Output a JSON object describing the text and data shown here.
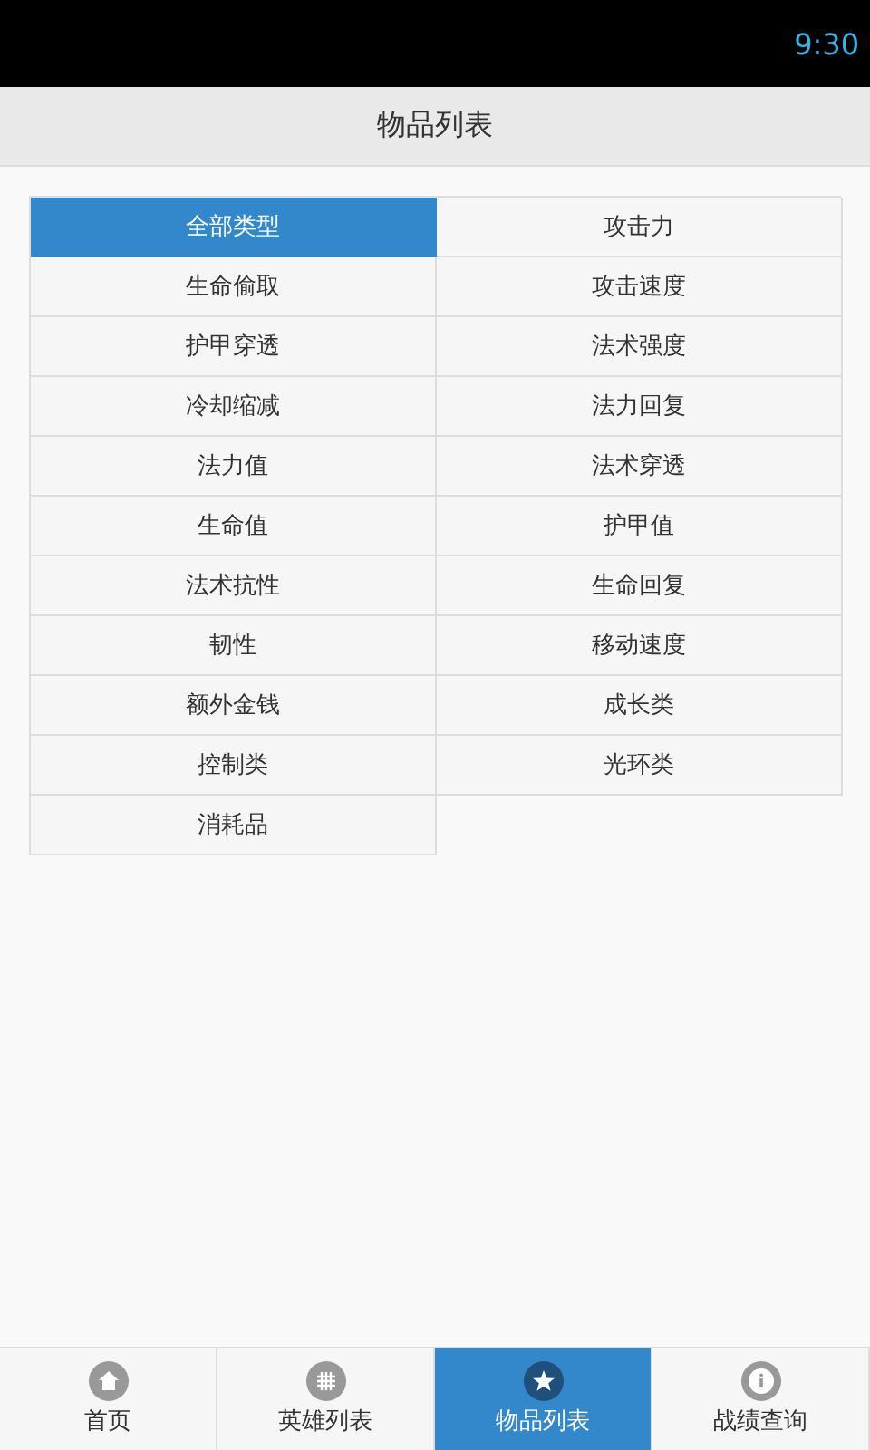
{
  "status_bar": {
    "time": "9:30"
  },
  "header": {
    "title": "物品列表"
  },
  "categories": [
    {
      "label": "全部类型",
      "selected": true
    },
    {
      "label": "攻击力",
      "selected": false
    },
    {
      "label": "生命偷取",
      "selected": false
    },
    {
      "label": "攻击速度",
      "selected": false
    },
    {
      "label": "护甲穿透",
      "selected": false
    },
    {
      "label": "法术强度",
      "selected": false
    },
    {
      "label": "冷却缩减",
      "selected": false
    },
    {
      "label": "法力回复",
      "selected": false
    },
    {
      "label": "法力值",
      "selected": false
    },
    {
      "label": "法术穿透",
      "selected": false
    },
    {
      "label": "生命值",
      "selected": false
    },
    {
      "label": "护甲值",
      "selected": false
    },
    {
      "label": "法术抗性",
      "selected": false
    },
    {
      "label": "生命回复",
      "selected": false
    },
    {
      "label": "韧性",
      "selected": false
    },
    {
      "label": "移动速度",
      "selected": false
    },
    {
      "label": "额外金钱",
      "selected": false
    },
    {
      "label": "成长类",
      "selected": false
    },
    {
      "label": "控制类",
      "selected": false
    },
    {
      "label": "光环类",
      "selected": false
    },
    {
      "label": "消耗品",
      "selected": false
    }
  ],
  "tab_bar": [
    {
      "label": "首页",
      "kind": "home",
      "selected": false
    },
    {
      "label": "英雄列表",
      "kind": "grid",
      "selected": false
    },
    {
      "label": "物品列表",
      "kind": "star",
      "selected": true
    },
    {
      "label": "战绩查询",
      "kind": "info",
      "selected": false
    }
  ]
}
